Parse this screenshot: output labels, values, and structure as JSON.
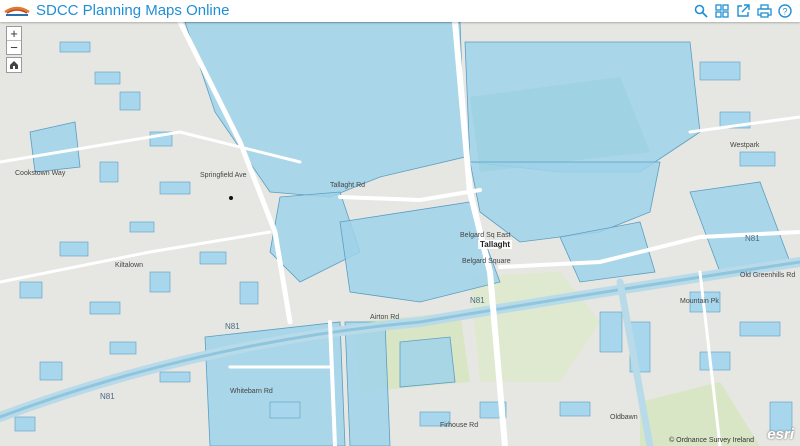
{
  "header": {
    "title": "SDCC Planning Maps Online",
    "tools": [
      {
        "name": "search-icon"
      },
      {
        "name": "apps-grid-icon"
      },
      {
        "name": "share-icon"
      },
      {
        "name": "print-icon"
      },
      {
        "name": "help-icon"
      }
    ]
  },
  "map_controls": {
    "zoom_in": "+",
    "zoom_out": "−",
    "home_icon": "home-icon"
  },
  "labels": {
    "place_tallaght": "Tallaght",
    "road_n81_west": "N81",
    "road_n81_center": "N81",
    "road_n81_east": "N81",
    "road_n81_south": "N81",
    "street_1": "Belgard Square",
    "street_2": "Tallaght Rd",
    "street_3": "Airton Rd",
    "street_4": "Belgard Sq East",
    "street_5": "Mountain Pk",
    "street_6": "Old Greenhills Rd",
    "street_7": "Oldbawn",
    "street_8": "Whitebarn Rd",
    "street_9": "Firhouse Rd",
    "street_10": "Kiltalown",
    "street_11": "Springfield Ave",
    "street_12": "Westpark",
    "street_13": "Cookstown Way"
  },
  "attribution": "© Ordnance Survey Ireland",
  "esri": "esri"
}
